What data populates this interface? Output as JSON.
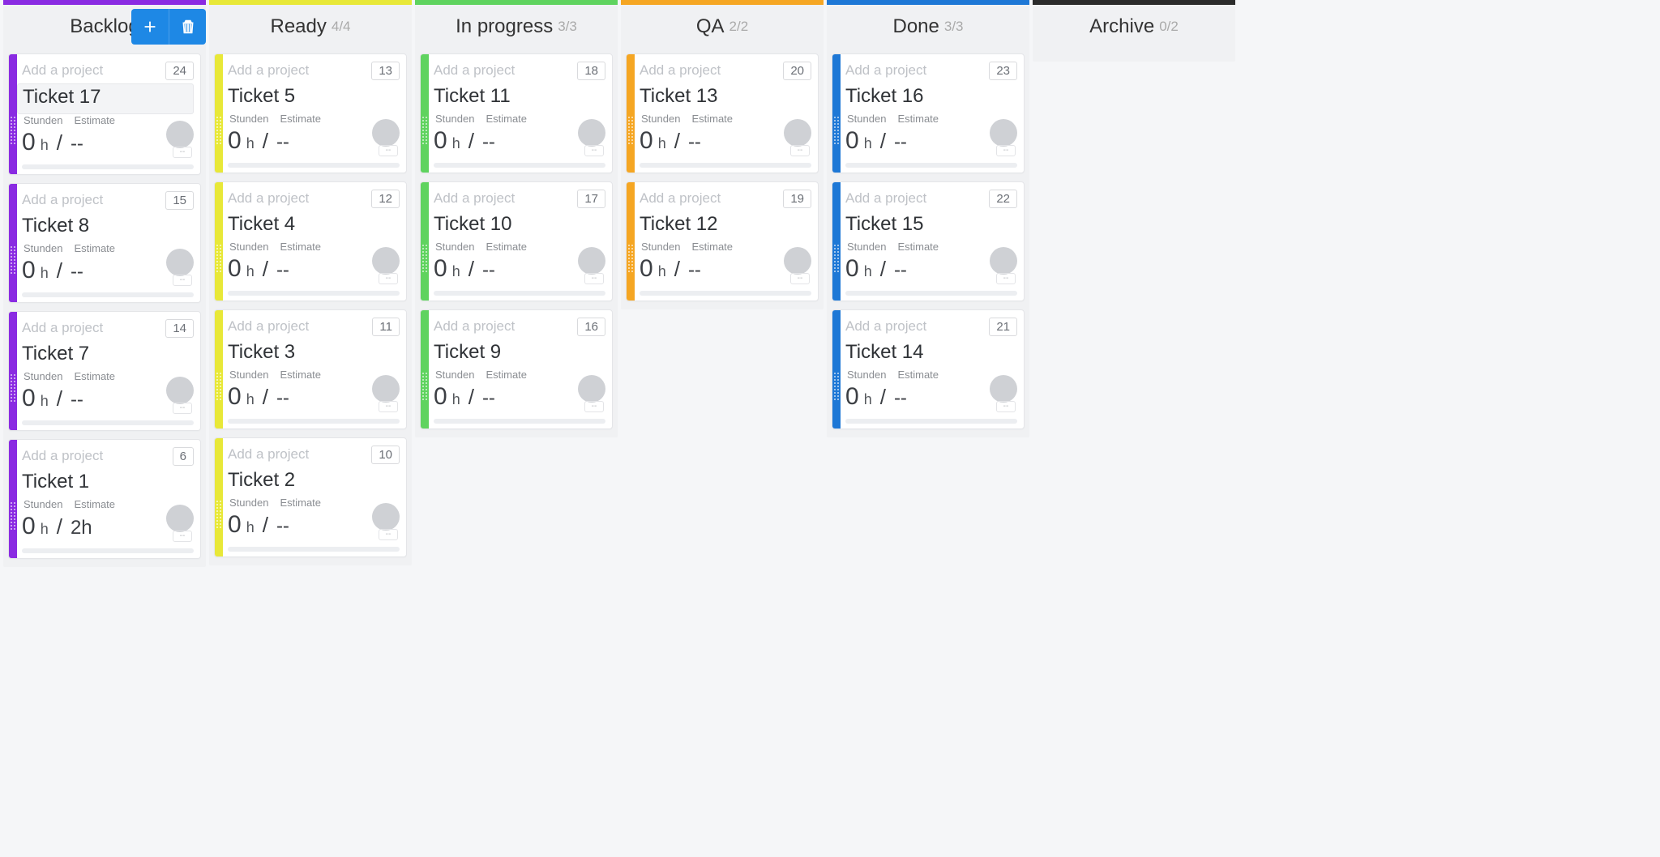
{
  "labels": {
    "project_placeholder": "Add a project",
    "hours_label": "Stunden",
    "estimate_label": "Estimate",
    "hours_unit": "h",
    "no_estimate": "--",
    "blank_pill": "--"
  },
  "columns": [
    {
      "id": "backlog",
      "title": "Backlog",
      "wip": "",
      "color": "c-purple",
      "show_actions": true,
      "cards": [
        {
          "number": "24",
          "title": "Ticket 17",
          "hours": "0",
          "estimate": "--",
          "selected": true
        },
        {
          "number": "15",
          "title": "Ticket 8",
          "hours": "0",
          "estimate": "--"
        },
        {
          "number": "14",
          "title": "Ticket 7",
          "hours": "0",
          "estimate": "--"
        },
        {
          "number": "6",
          "title": "Ticket 1",
          "hours": "0",
          "estimate": "2h"
        }
      ]
    },
    {
      "id": "ready",
      "title": "Ready",
      "wip": "4/4",
      "color": "c-yellow",
      "cards": [
        {
          "number": "13",
          "title": "Ticket 5",
          "hours": "0",
          "estimate": "--"
        },
        {
          "number": "12",
          "title": "Ticket 4",
          "hours": "0",
          "estimate": "--"
        },
        {
          "number": "11",
          "title": "Ticket 3",
          "hours": "0",
          "estimate": "--"
        },
        {
          "number": "10",
          "title": "Ticket 2",
          "hours": "0",
          "estimate": "--"
        }
      ]
    },
    {
      "id": "inprogress",
      "title": "In progress",
      "wip": "3/3",
      "color": "c-green",
      "cards": [
        {
          "number": "18",
          "title": "Ticket 11",
          "hours": "0",
          "estimate": "--"
        },
        {
          "number": "17",
          "title": "Ticket 10",
          "hours": "0",
          "estimate": "--"
        },
        {
          "number": "16",
          "title": "Ticket 9",
          "hours": "0",
          "estimate": "--"
        }
      ]
    },
    {
      "id": "qa",
      "title": "QA",
      "wip": "2/2",
      "color": "c-orange",
      "cards": [
        {
          "number": "20",
          "title": "Ticket 13",
          "hours": "0",
          "estimate": "--"
        },
        {
          "number": "19",
          "title": "Ticket 12",
          "hours": "0",
          "estimate": "--"
        }
      ]
    },
    {
      "id": "done",
      "title": "Done",
      "wip": "3/3",
      "color": "c-blue",
      "cards": [
        {
          "number": "23",
          "title": "Ticket 16",
          "hours": "0",
          "estimate": "--"
        },
        {
          "number": "22",
          "title": "Ticket 15",
          "hours": "0",
          "estimate": "--"
        },
        {
          "number": "21",
          "title": "Ticket 14",
          "hours": "0",
          "estimate": "--"
        }
      ]
    },
    {
      "id": "archive",
      "title": "Archive",
      "wip": "0/2",
      "color": "c-dark",
      "cards": []
    }
  ]
}
